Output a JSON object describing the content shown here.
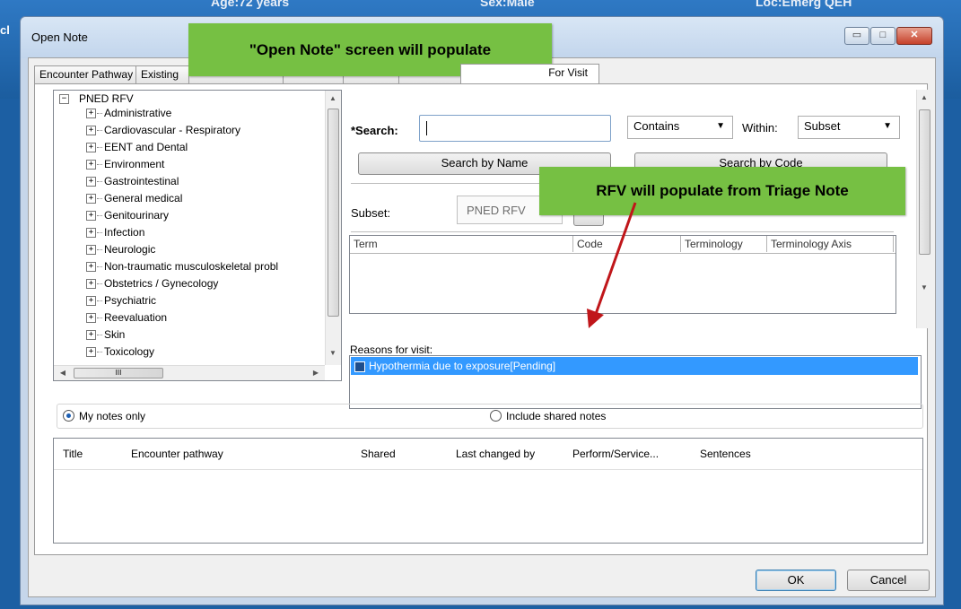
{
  "background": {
    "age": "Age:72 years",
    "sex": "Sex:Male",
    "location": "Loc:Emerg QEH",
    "left_char": "cl"
  },
  "dialog": {
    "title": "Open Note",
    "minimize": "▭",
    "maximize": "□",
    "close": "✕"
  },
  "tabs": [
    {
      "label": "Encounter Pathway"
    },
    {
      "label": "Existing"
    },
    {
      "label": ""
    },
    {
      "label": ""
    },
    {
      "label": ""
    },
    {
      "label": ""
    },
    {
      "label": "For Visit"
    }
  ],
  "tree": {
    "root": "PNED RFV",
    "items": [
      "Administrative",
      "Cardiovascular - Respiratory",
      "EENT and Dental",
      "Environment",
      "Gastrointestinal",
      "General medical",
      "Genitourinary",
      "Infection",
      "Neurologic",
      "Non-traumatic musculoskeletal probl",
      "Obstetrics / Gynecology",
      "Psychiatric",
      "Reevaluation",
      "Skin",
      "Toxicology"
    ],
    "hscroll_glyph": "III"
  },
  "search": {
    "label": "*Search:",
    "value": "",
    "match_mode": "Contains",
    "within_label": "Within:",
    "within_value": "Subset",
    "by_name": "Search by Name",
    "by_code": "Search by Code"
  },
  "subset": {
    "label": "Subset:",
    "value": "PNED RFV"
  },
  "results_grid": {
    "columns": [
      "Term",
      "Code",
      "Terminology",
      "Terminology Axis"
    ]
  },
  "reasons": {
    "label": "Reasons for visit:",
    "items": [
      "Hypothermia due to exposure[Pending]"
    ]
  },
  "notes_filter": {
    "my_notes": "My notes only",
    "shared_notes": "Include shared notes",
    "selected": "my_notes"
  },
  "notes_grid": {
    "columns": [
      "Title",
      "Encounter pathway",
      "Shared",
      "Last changed by",
      "Perform/Service...",
      "Sentences"
    ]
  },
  "footer": {
    "ok": "OK",
    "cancel": "Cancel"
  },
  "callouts": {
    "open_note": "\"Open Note\" screen will populate",
    "rfv": "RFV will populate from Triage Note"
  },
  "colors": {
    "callout_green": "#76c043",
    "arrow_red": "#c0161a",
    "selection_blue": "#3399ff"
  }
}
